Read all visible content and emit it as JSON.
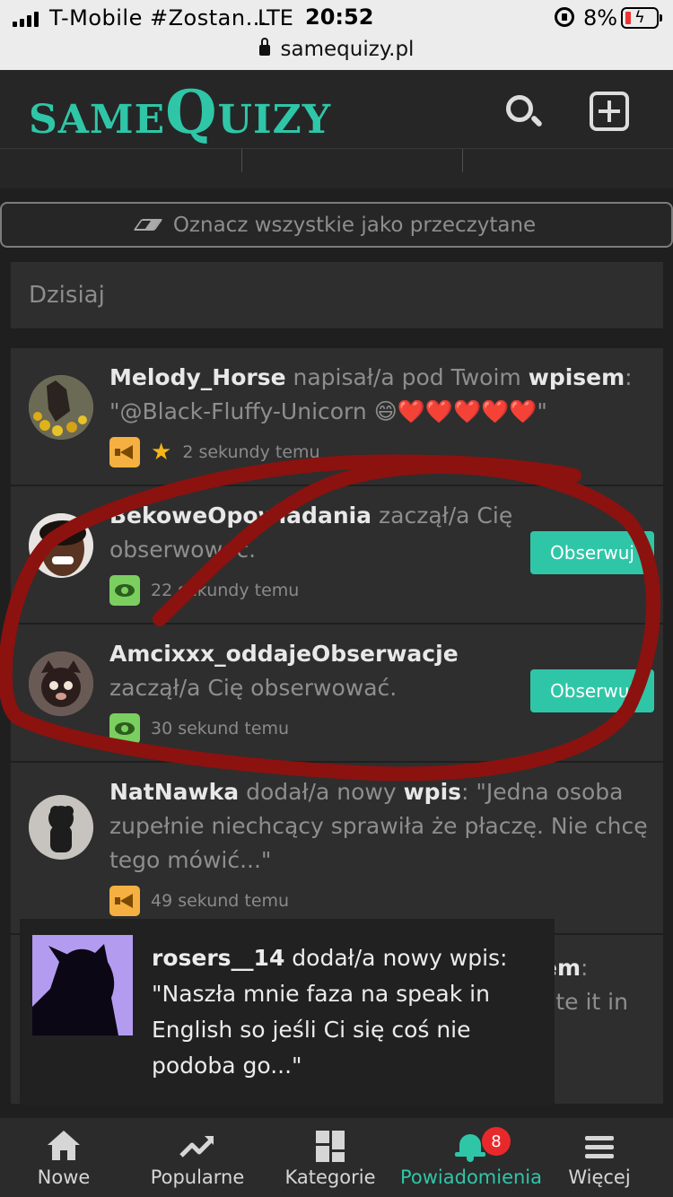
{
  "status_bar": {
    "carrier": "T-Mobile #Zostan…",
    "network": "LTE",
    "time": "20:52",
    "battery": "8%",
    "battery_color": "#e33333"
  },
  "url": "samequizy.pl",
  "header": {
    "logo_prefix": "SAME",
    "logo_q": "Q",
    "logo_suffix": "UIZY",
    "accent": "#2fc6a8"
  },
  "mark_all_label": "Oznacz wszystkie jako przeczytane",
  "section_label": "Dzisiaj",
  "notifications": [
    {
      "user": "Melody_Horse",
      "action": " napisał/a pod Twoim ",
      "object": "wpisem",
      "tail": ":",
      "quote": "\"@Black-Fluffy-Unicorn 😄❤️❤️❤️❤️❤️\"",
      "time": "2 sekundy temu",
      "badge": "megaphone-icon",
      "starred": true
    },
    {
      "user": "BekoweOpowiadania",
      "action": " zaczął/a Cię obserwować.",
      "time": "22 sekundy temu",
      "badge": "eye-icon",
      "button": "Obserwuj"
    },
    {
      "user": "Amcixxx_oddajeObserwacje",
      "action": " zaczął/a Cię obserwować.",
      "time": "30 sekund temu",
      "badge": "eye-icon",
      "button": "Obserwuj"
    },
    {
      "user": "NatNawka",
      "action": " dodał/a nowy ",
      "object": "wpis",
      "tail": ": \"Jedna osoba zupełnie niechcący sprawiła że płaczę. Nie chcę tego mówić...\"",
      "time": "49 sekund temu",
      "badge": "megaphone-icon"
    },
    {
      "object": "em",
      "tail": ":",
      "quote": "ate it in"
    }
  ],
  "toast": {
    "user": "rosers__14",
    "text": " dodał/a nowy wpis: \"Naszła mnie faza na speak in English so jeśli Ci się coś nie podoba go...\""
  },
  "bottom_nav": [
    {
      "label": "Nowe",
      "icon": "home-icon"
    },
    {
      "label": "Popularne",
      "icon": "trending-icon"
    },
    {
      "label": "Kategorie",
      "icon": "grid-icon"
    },
    {
      "label": "Powiadomienia",
      "icon": "bell-icon",
      "active": true,
      "badge": "8"
    },
    {
      "label": "Więcej",
      "icon": "menu-icon"
    }
  ]
}
